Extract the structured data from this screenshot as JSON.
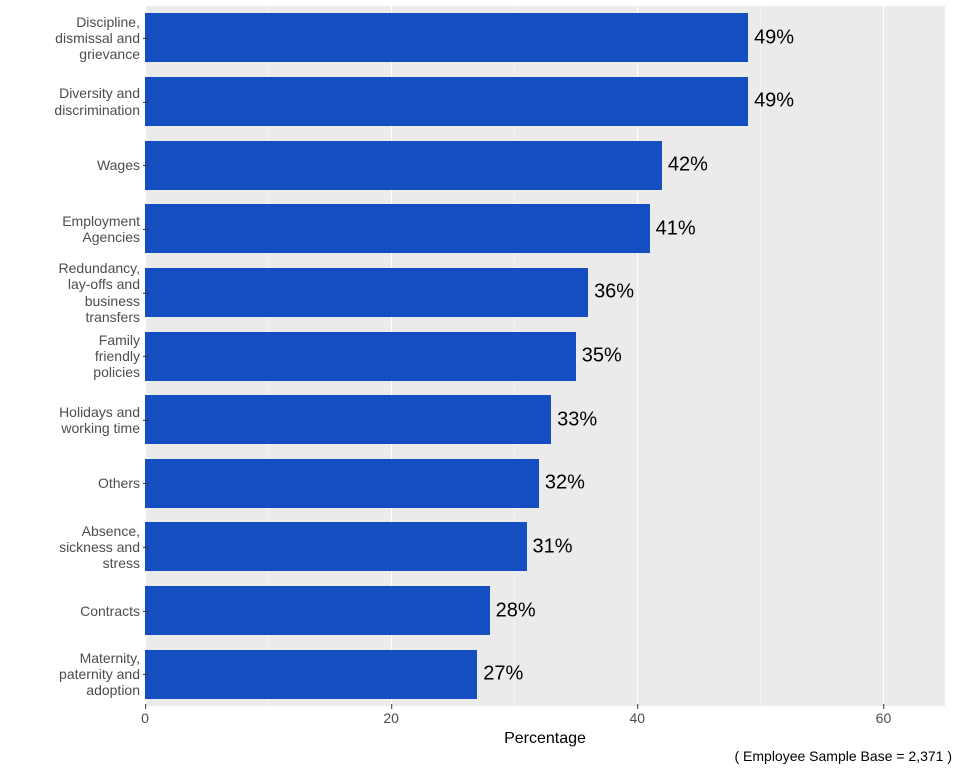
{
  "chart_data": {
    "type": "bar",
    "orientation": "horizontal",
    "categories": [
      "Discipline, dismissal and grievance",
      "Diversity and discrimination",
      "Wages",
      "Employment Agencies",
      "Redundancy, lay-offs and business transfers",
      "Family friendly policies",
      "Holidays and working time",
      "Others",
      "Absence, sickness and stress",
      "Contracts",
      "Maternity, paternity and adoption"
    ],
    "values": [
      49,
      49,
      42,
      41,
      36,
      35,
      33,
      32,
      31,
      28,
      27
    ],
    "value_labels": [
      "49%",
      "49%",
      "42%",
      "41%",
      "36%",
      "35%",
      "33%",
      "32%",
      "31%",
      "28%",
      "27%"
    ],
    "title": "",
    "xlabel": "Percentage",
    "ylabel": "",
    "xlim": [
      0,
      65
    ],
    "xticks": [
      0,
      20,
      40,
      60
    ],
    "bar_color": "#154ec1",
    "panel_background": "#ebebeb",
    "footnote": "( Employee Sample Base =  2,371 )"
  },
  "ytick_lines": [
    [
      "Discipline,",
      "dismissal and",
      "grievance"
    ],
    [
      "Diversity and",
      "discrimination"
    ],
    [
      "Wages"
    ],
    [
      "Employment",
      "Agencies"
    ],
    [
      "Redundancy,",
      "lay-offs and",
      "business",
      "transfers"
    ],
    [
      "Family",
      "friendly",
      "policies"
    ],
    [
      "Holidays and",
      "working time"
    ],
    [
      "Others"
    ],
    [
      "Absence,",
      "sickness and",
      "stress"
    ],
    [
      "Contracts"
    ],
    [
      "Maternity,",
      "paternity and",
      "adoption"
    ]
  ]
}
